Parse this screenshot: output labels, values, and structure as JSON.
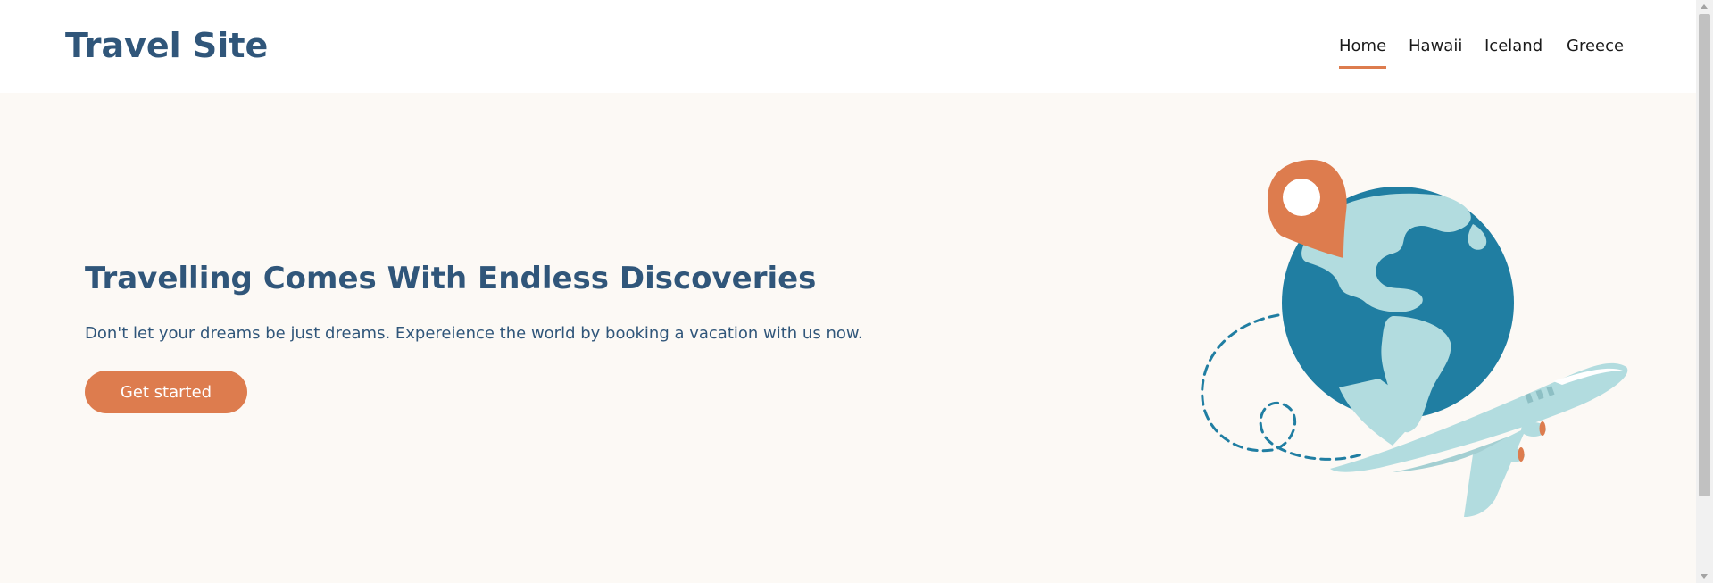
{
  "header": {
    "site_title": "Travel Site",
    "nav": [
      {
        "label": "Home",
        "active": true
      },
      {
        "label": "Hawaii",
        "active": false
      },
      {
        "label": "Iceland",
        "active": false
      },
      {
        "label": "Greece",
        "active": false
      }
    ]
  },
  "hero": {
    "title": "Travelling Comes With Endless Discoveries",
    "subtitle": "Don't let your dreams be just dreams. Expereience the world by booking a vacation with us now.",
    "cta_label": "Get started",
    "illustration_icons": [
      "location-pin-icon",
      "globe-icon",
      "airplane-icon",
      "dashed-flight-path"
    ]
  },
  "colors": {
    "brand_blue": "#30567a",
    "accent_orange": "#dd7c4e",
    "hero_background": "#fcf9f5",
    "globe_blue": "#207ea2",
    "land_light": "#b2dcdf"
  }
}
